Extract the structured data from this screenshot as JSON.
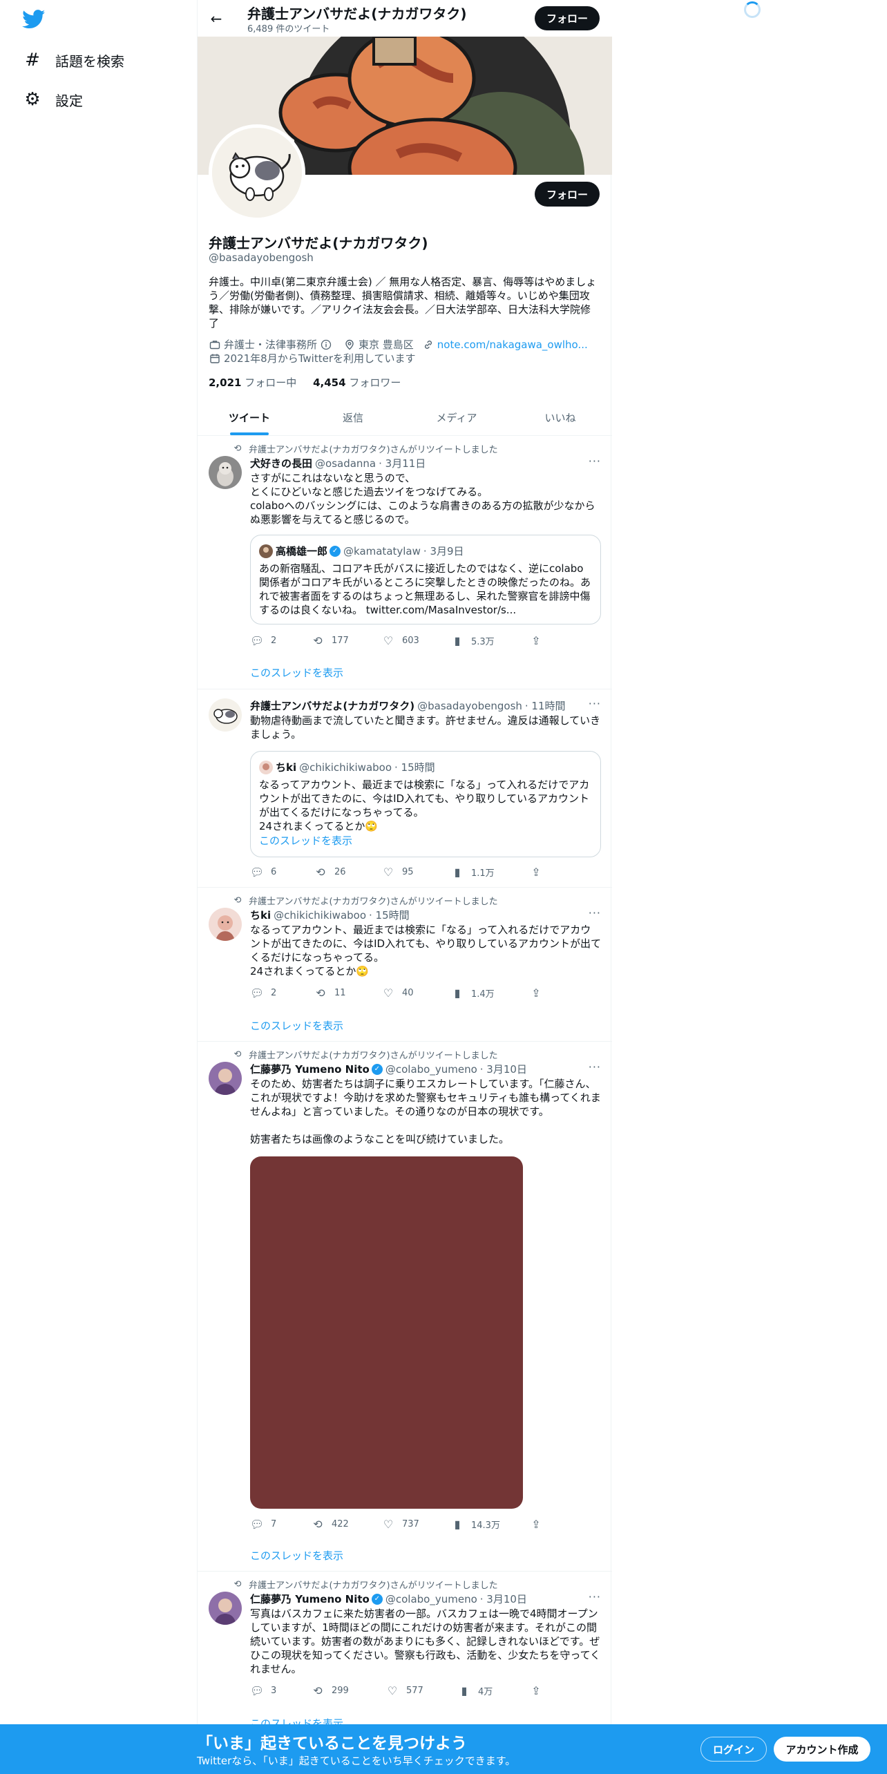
{
  "nav": {
    "items": [
      {
        "icon": "hashtag-icon",
        "label": "話題を検索"
      },
      {
        "icon": "gear-icon",
        "label": "設定"
      }
    ]
  },
  "header": {
    "name": "弁護士アンバサだよ(ナカガワタク)",
    "tweet_count": "6,489 件のツイート",
    "follow_label": "フォロー"
  },
  "profile": {
    "name": "弁護士アンバサだよ(ナカガワタク)",
    "handle": "@basadayobengosh",
    "follow_label": "フォロー",
    "bio": "弁護士。中川卓(第二東京弁護士会) ／ 無用な人格否定、暴言、侮辱等はやめましょう／労働(労働者側)、債務整理、損害賠償請求、相続、離婚等々。いじめや集団攻撃、排除が嫌いです。／アリクイ法友会会長。／日大法学部卒、日大法科大学院修了",
    "category": "弁護士・法律事務所",
    "location": "東京 豊島区",
    "url": "note.com/nakagawa_owlho...",
    "joined": "2021年8月からTwitterを利用しています",
    "following_count": "2,021",
    "following_label": "フォロー中",
    "followers_count": "4,454",
    "followers_label": "フォロワー"
  },
  "tabs": [
    "ツイート",
    "返信",
    "メディア",
    "いいね"
  ],
  "tweets": [
    {
      "retweeted_by": "弁護士アンバサだよ(ナカガワタク)さんがリツイートしました",
      "name": "犬好きの長田",
      "handle": "@osadanna",
      "time": "· 3月11日",
      "text": "さすがにこれはないなと思うので、\nとくにひどいなと感じた過去ツイをつなげてみる。\ncolaboへのバッシングには、このような肩書きのある方の拡散が少なからぬ悪影響を与えてると感じるので。",
      "quote": {
        "name": "高橋雄一郎",
        "handle": "@kamatatylaw",
        "time": "· 3月9日",
        "text": "あの新宿騒乱、コロアキ氏がバスに接近したのではなく、逆にcolabo関係者がコロアキ氏がいるところに突撃したときの映像だったのね。あれで被害者面をするのはちょっと無理あるし、呆れた警察官を誹謗中傷するのは良くないね。 twitter.com/MasaInvestor/s..."
      },
      "replies": "2",
      "retweets": "177",
      "likes": "603",
      "views": "5.3万",
      "thread_link": "このスレッドを表示"
    },
    {
      "name": "弁護士アンバサだよ(ナカガワタク)",
      "handle": "@basadayobengosh",
      "time": "· 11時間",
      "text": "動物虐待動画まで流していたと聞きます。許せません。違反は通報していきましょう。",
      "quote": {
        "name": "ちki",
        "handle": "@chikichikiwaboo",
        "time": "· 15時間",
        "text": "なるってアカウント、最近までは検索に「なる」って入れるだけでアカウントが出てきたのに、今はID入れても、やり取りしているアカウントが出てくるだけになっちゃってる。\n24されまくってるとか🙄",
        "thread_link": "このスレッドを表示"
      },
      "replies": "6",
      "retweets": "26",
      "likes": "95",
      "views": "1.1万"
    },
    {
      "retweeted_by": "弁護士アンバサだよ(ナカガワタク)さんがリツイートしました",
      "name": "ちki",
      "handle": "@chikichikiwaboo",
      "time": "· 15時間",
      "text": "なるってアカウント、最近までは検索に「なる」って入れるだけでアカウントが出てきたのに、今はID入れても、やり取りしているアカウントが出てくるだけになっちゃってる。\n24されまくってるとか🙄",
      "replies": "2",
      "retweets": "11",
      "likes": "40",
      "views": "1.4万",
      "thread_link": "このスレッドを表示"
    },
    {
      "retweeted_by": "弁護士アンバサだよ(ナカガワタク)さんがリツイートしました",
      "name": "仁藤夢乃 Yumeno Nito",
      "handle": "@colabo_yumeno",
      "time": "· 3月10日",
      "text": "そのため、妨害者たちは調子に乗りエスカレートしています。「仁藤さん、これが現状ですよ！今助けを求めた警察もセキュリティも誰も構ってくれませんよね」と言っていました。その通りなのが日本の現状です。\n\n妨害者たちは画像のようなことを叫び続けていました。",
      "replies": "7",
      "retweets": "422",
      "likes": "737",
      "views": "14.3万",
      "thread_link": "このスレッドを表示"
    },
    {
      "retweeted_by": "弁護士アンバサだよ(ナカガワタク)さんがリツイートしました",
      "name": "仁藤夢乃 Yumeno Nito",
      "handle": "@colabo_yumeno",
      "time": "· 3月10日",
      "text": "写真はバスカフェに来た妨害者の一部。バスカフェは一晩で4時間オープンしていますが、1時間ほどの間にこれだけの妨害者が来ます。それがこの間続いています。妨害者の数があまりにも多く、記録しきれないほどです。ぜひこの現状を知ってください。警察も行政も、活動を、少女たちを守ってくれません。",
      "replies": "3",
      "retweets": "299",
      "likes": "577",
      "views": "4万",
      "thread_link": "このスレッドを表示"
    }
  ],
  "bottom_bar": {
    "title": "「いま」起きていることを見つけよう",
    "subtitle": "Twitterなら、「いま」起きていることをいち早くチェックできます。",
    "login_label": "ログイン",
    "signup_label": "アカウント作成"
  },
  "colors": {
    "accent": "#1d9bf0",
    "text": "#0f1419",
    "muted": "#536471",
    "media": "#733535"
  }
}
